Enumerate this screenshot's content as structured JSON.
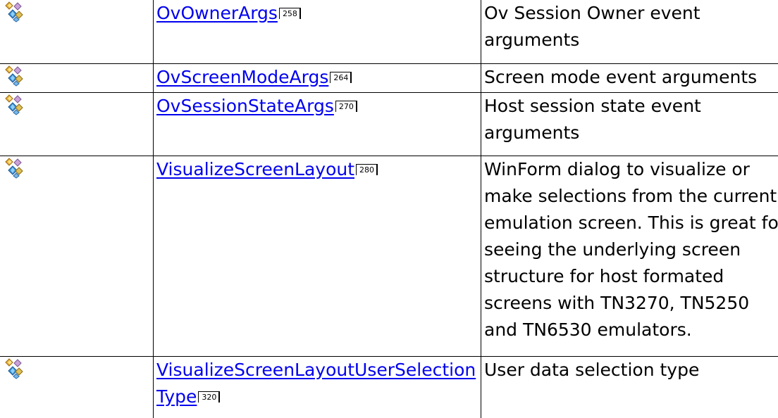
{
  "colors": {
    "link": "#0000ee",
    "border": "#000000",
    "text": "#000000"
  },
  "rows": [
    {
      "icon": "class-icon",
      "name": "OvOwnerArgs",
      "page": "258",
      "description": "Ov Session Owner event arguments"
    },
    {
      "icon": "class-icon",
      "name": "OvScreenModeArgs",
      "page": "264",
      "description": "Screen mode event arguments"
    },
    {
      "icon": "class-icon",
      "name": "OvSessionStateArgs",
      "page": "270",
      "description": "Host session state event arguments"
    },
    {
      "icon": "class-icon",
      "name": "VisualizeScreenLayout",
      "page": "280",
      "description": "WinForm dialog to visualize or make selections from the current emulation screen. This is great for seeing the underlying screen structure for host formated screens with TN3270, TN5250 and TN6530 emulators."
    },
    {
      "icon": "class-icon",
      "name": "VisualizeScreenLayoutUserSelectionType",
      "page": "320",
      "description": "User data selection type"
    }
  ]
}
